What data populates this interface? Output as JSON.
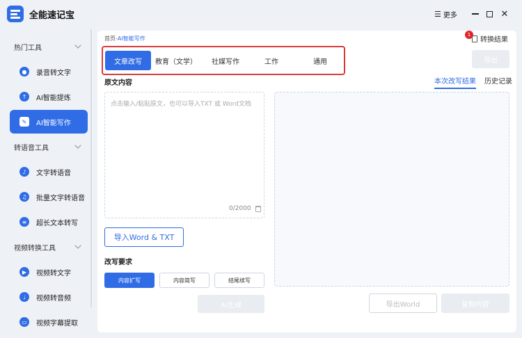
{
  "app": {
    "title": "全能速记宝",
    "more_label": "更多"
  },
  "sidebar": {
    "groups": [
      {
        "label": "热门工具"
      },
      {
        "label": "转语音工具"
      },
      {
        "label": "视频转换工具"
      }
    ],
    "items": [
      {
        "label": "录音转文字"
      },
      {
        "label": "AI智能提炼"
      },
      {
        "label": "AI智能写作"
      },
      {
        "label": "文字转语音"
      },
      {
        "label": "批量文字转语音"
      },
      {
        "label": "超长文本转写"
      },
      {
        "label": "视频转文字"
      },
      {
        "label": "视频转音频"
      },
      {
        "label": "视频字幕提取"
      }
    ],
    "active_index": 2
  },
  "main": {
    "breadcrumb": {
      "home": "首页",
      "sep": "-",
      "current": "AI智能写作"
    },
    "result_link": "转换结果",
    "result_badge": "1",
    "tabs": [
      {
        "label": "文章改写"
      },
      {
        "label": "教育（文学）"
      },
      {
        "label": "社媒写作"
      },
      {
        "label": "工作"
      },
      {
        "label": "通用"
      }
    ],
    "export_label": "导出",
    "source_title": "原文内容",
    "result_tabs": [
      {
        "label": "本次改写结果"
      },
      {
        "label": "历史记录"
      }
    ],
    "input": {
      "placeholder": "点击输入/粘贴原文，也可以导入TXT 或 Word文档",
      "value": "",
      "counter": "0/2000"
    },
    "import_label": "导入Word & TXT",
    "requirements_title": "改写要求",
    "options": [
      {
        "label": "内容扩写"
      },
      {
        "label": "内容简写"
      },
      {
        "label": "结尾续写"
      }
    ],
    "ai_generate_label": "AI生成",
    "export_word_label": "导出World",
    "copy_label": "复制内容"
  }
}
